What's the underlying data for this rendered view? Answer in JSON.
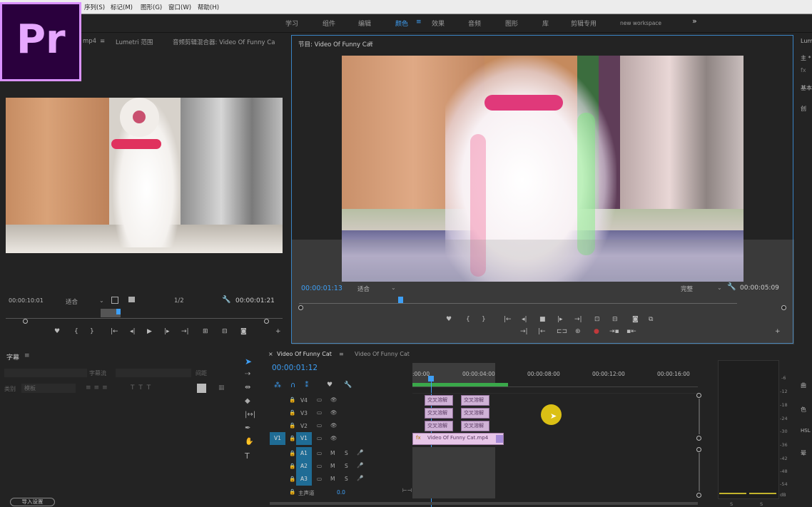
{
  "menu": [
    "序列(S)",
    "标记(M)",
    "图形(G)",
    "窗口(W)",
    "帮助(H)"
  ],
  "app_logo": "Pr",
  "workspaces": [
    "学习",
    "组件",
    "编辑",
    "颜色",
    "效果",
    "音频",
    "图形",
    "库",
    "剪辑专用",
    "new workspace"
  ],
  "workspaces_more": "»",
  "active_workspace": "颜色",
  "active_workspace_menu": "≡",
  "source": {
    "tab1": "mp4",
    "tab1_menu": "≡",
    "tab2": "Lumetri 范围",
    "tab3": "音频剪辑混合器: Video Of Funny Ca",
    "timecode": "00:00:10:01",
    "fit": "适合",
    "resolution": "1/2",
    "duration": "00:00:01:21"
  },
  "program": {
    "tab": "节目: Video Of Funny Cat",
    "tab_menu": "≡",
    "timecode": "00:00:01:13",
    "fit": "适合",
    "quality": "完整",
    "duration": "00:00:05:09"
  },
  "right_panel": {
    "items": [
      "Lum",
      "主 *",
      "fx",
      "基本",
      "创",
      "曲",
      "色",
      "HSL",
      "晕"
    ]
  },
  "captions": {
    "title": "字幕",
    "title_menu": "≡",
    "style_label": "字幕流",
    "position_label": "间距",
    "category_label": "类别",
    "category_value": "模板",
    "import_button": "导入设置"
  },
  "timeline": {
    "tab1": "Video Of Funny Cat",
    "tab1_close": "×",
    "tab1_menu": "≡",
    "tab2": "Video Of Funny Cat",
    "timecode": "00:00:01:12",
    "ruler": [
      ":00:00",
      "00:00:04:00",
      "00:00:08:00",
      "00:00:12:00",
      "00:00:16:00"
    ],
    "tracks": [
      {
        "name": "V4"
      },
      {
        "name": "V3"
      },
      {
        "name": "V2"
      },
      {
        "name": "V1",
        "src": "V1"
      },
      {
        "name": "A1"
      },
      {
        "name": "A2"
      },
      {
        "name": "A3"
      }
    ],
    "clip_main": "Video Of Funny Cat.mp4",
    "clip_fx": "fx",
    "clips_small": [
      "交叉溶解",
      "交叉溶解",
      "交叉溶解",
      "交叉溶解",
      "交叉溶解",
      "交叉溶解"
    ],
    "master": "主声道",
    "master_value": "0.0",
    "mute": "M",
    "solo": "S"
  },
  "vu": {
    "labels": [
      "-6",
      "-12",
      "-18",
      "-24",
      "-30",
      "-36",
      "-42",
      "-48",
      "-54",
      "dB"
    ],
    "s": [
      "S",
      "S"
    ]
  },
  "colors": {
    "accent": "#3e9ff5",
    "pr_purple": "#d992ff",
    "pr_bg": "#2a003d",
    "track_blue": "#1f6c95"
  }
}
